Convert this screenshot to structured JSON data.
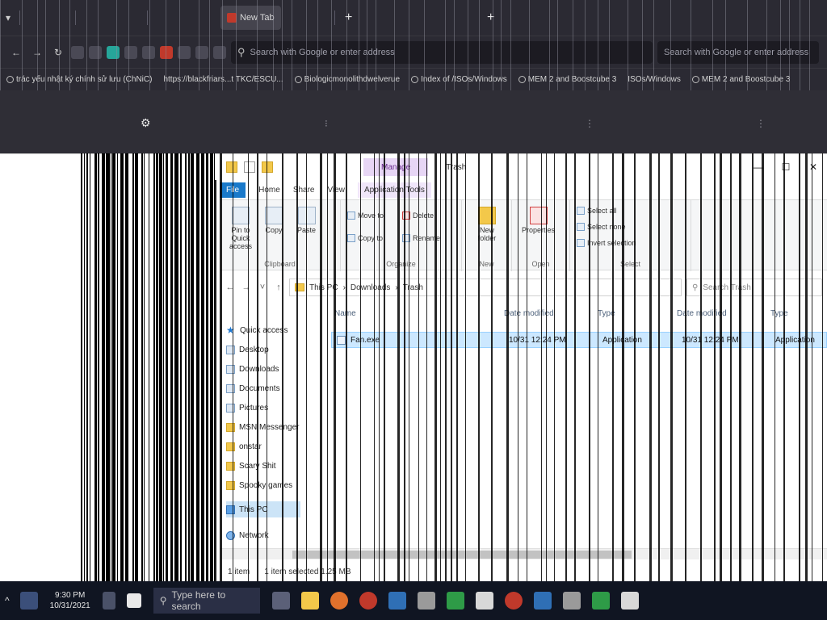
{
  "browser": {
    "tabs": [
      {
        "label": "New Tab"
      }
    ],
    "new_tab_symbol": "+",
    "search_placeholder": "Search with Google or enter address",
    "bookmarks": [
      "trác yếu nhật ký chính sử lưu (ChNiC)",
      "https://blackfriars...t TKC/ESCU...",
      "Biologicmonolithdwelverue",
      "Index of /ISOs/Windows",
      "MEM 2 and Boostcube 3",
      "ISOs/Windows",
      "MEM 2 and Boostcube 3"
    ]
  },
  "explorer": {
    "title": "Trash",
    "contextual_tab": "Manage",
    "ribbon_tabs": [
      "File",
      "Home",
      "Share",
      "View",
      "Application Tools"
    ],
    "ribbon": {
      "clipboard": {
        "label": "Clipboard",
        "pin": "Pin to Quick access",
        "copy": "Copy",
        "paste": "Paste"
      },
      "organize": {
        "label": "Organize",
        "move_to": "Move to",
        "delete": "Delete",
        "copy_to": "Copy to",
        "rename": "Rename"
      },
      "new": {
        "label": "New",
        "new_folder": "New folder"
      },
      "open": {
        "label": "Open",
        "properties": "Properties"
      },
      "select": {
        "label": "Select",
        "select_all": "Select all",
        "select_none": "Select none",
        "invert": "Invert selection"
      }
    },
    "address": {
      "path": [
        "This PC",
        "Downloads",
        "Trash"
      ],
      "search_placeholder": "Search Trash"
    },
    "nav": [
      {
        "label": "Quick access",
        "kind": "star"
      },
      {
        "label": "Desktop",
        "kind": "folder-blue"
      },
      {
        "label": "Downloads",
        "kind": "folder-blue"
      },
      {
        "label": "Documents",
        "kind": "folder-blue"
      },
      {
        "label": "Pictures",
        "kind": "folder-blue"
      },
      {
        "label": "MSN Messenger",
        "kind": "folder"
      },
      {
        "label": "onstar",
        "kind": "folder"
      },
      {
        "label": "Scary Shit",
        "kind": "folder"
      },
      {
        "label": "Spooky games",
        "kind": "folder"
      },
      {
        "label": "This PC",
        "kind": "pc"
      },
      {
        "label": "Network",
        "kind": "network"
      }
    ],
    "columns": [
      "Name",
      "Date modified",
      "Type"
    ],
    "file": {
      "name": "Fan.exe",
      "date": "10/31 12:24 PM",
      "type": "Application"
    },
    "status": {
      "count": "1 item",
      "selected": "1 item selected  1.25 MB"
    }
  },
  "taskbar": {
    "search_placeholder": "Type here to search",
    "clock_time": "9:30 PM",
    "clock_date": "10/31/2021"
  }
}
